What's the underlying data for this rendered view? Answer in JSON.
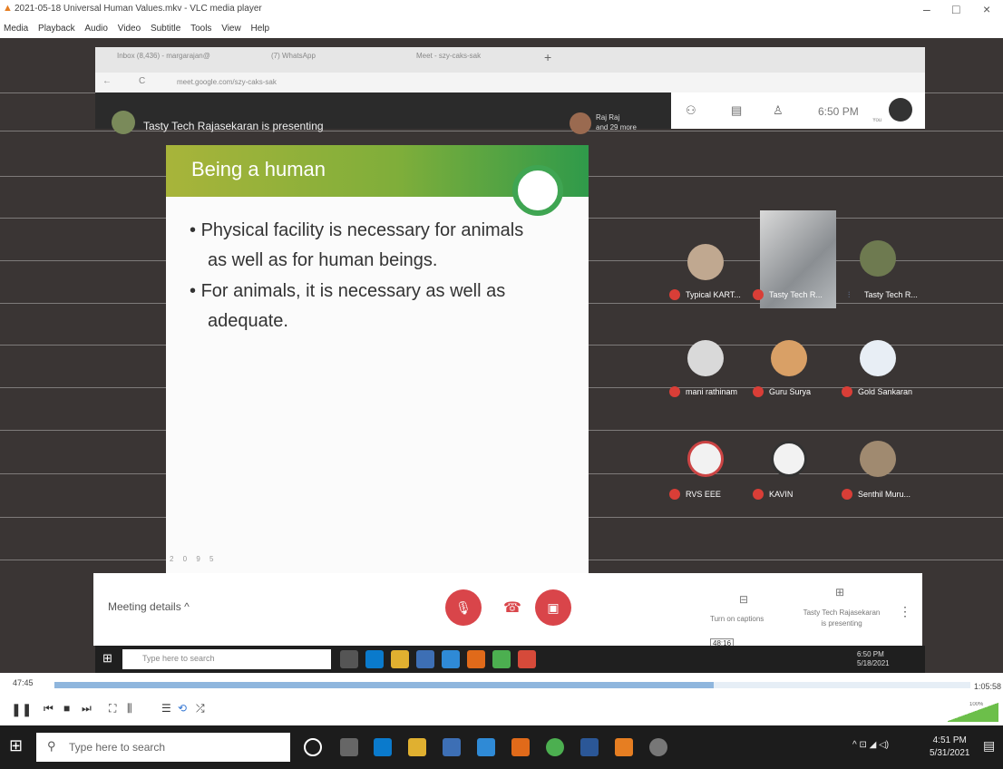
{
  "vlc": {
    "title": "2021-05-18 Universal Human Values.mkv - VLC media player",
    "menu": [
      "Media",
      "Playback",
      "Audio",
      "Video",
      "Subtitle",
      "Tools",
      "View",
      "Help"
    ],
    "time_current": "47:45",
    "time_total": "1:05:58",
    "progress_fraction": 0.72,
    "volume_label": "100%"
  },
  "chrome": {
    "tabs": [
      "Inbox (8,436) - margarajan@",
      "(7) WhatsApp",
      "Meet - szy-caks-sak"
    ],
    "url": "meet.google.com/szy-caks-sak"
  },
  "meet": {
    "presenting_text": "Tasty Tech Rajasekaran is presenting",
    "raj_line1": "Raj Raj",
    "raj_line2": "and 29 more",
    "clock": "6:50 PM",
    "you_label": "You",
    "meeting_details": "Meeting details",
    "captions": "Turn on captions",
    "present_line1": "Tasty Tech Rajasekaran",
    "present_line2": "is presenting",
    "time_tooltip": "48:16"
  },
  "slide": {
    "title": "Being a human",
    "bullets": [
      [
        "Physical facility is necessary for animals",
        "as well as for human beings."
      ],
      [
        "For animals, it is necessary as well as",
        "adequate."
      ]
    ],
    "footer": "2 0 9 5"
  },
  "participants": [
    {
      "name": "Typical KART..."
    },
    {
      "name": "Tasty Tech R..."
    },
    {
      "name": "Tasty Tech R..."
    },
    {
      "name": "mani rathinam"
    },
    {
      "name": "Guru Surya"
    },
    {
      "name": "Gold Sankaran"
    },
    {
      "name": "RVS EEE"
    },
    {
      "name": "KAVIN"
    },
    {
      "name": "Senthil Muru..."
    }
  ],
  "inner_taskbar": {
    "search": "Type here to search",
    "time": "6:50 PM",
    "date": "5/18/2021"
  },
  "outer_taskbar": {
    "search": "Type here to search",
    "time": "4:51 PM",
    "date": "5/31/2021"
  }
}
